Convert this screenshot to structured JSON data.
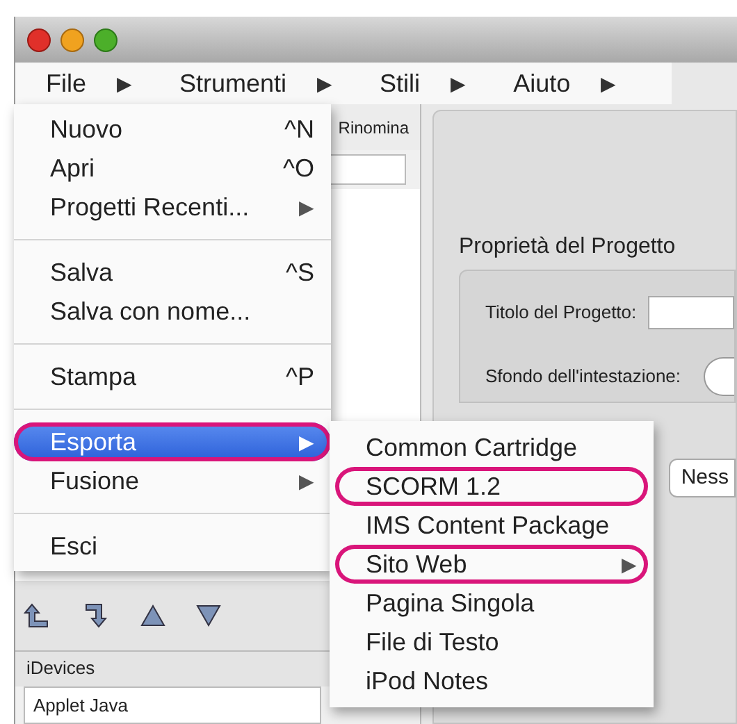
{
  "menubar": [
    {
      "label": "File",
      "arrow": "▶"
    },
    {
      "label": "Strumenti",
      "arrow": "▶"
    },
    {
      "label": "Stili",
      "arrow": "▶"
    },
    {
      "label": "Aiuto",
      "arrow": "▶"
    }
  ],
  "toolbar": {
    "label": "Rinomina"
  },
  "project_panel": {
    "title": "Proprietà del Progetto",
    "fields": [
      {
        "kind": "text",
        "label": "Titolo del Progetto:"
      },
      {
        "kind": "radio",
        "label": "Sfondo dell'intestazione:"
      }
    ],
    "button": "Ness"
  },
  "idevices": {
    "title": "iDevices",
    "items": [
      "Applet Java"
    ]
  },
  "file_menu": [
    {
      "kind": "item",
      "label": "Nuovo",
      "shortcut": "^N",
      "selected": false,
      "circled": false
    },
    {
      "kind": "item",
      "label": "Apri",
      "shortcut": "^O",
      "selected": false,
      "circled": false
    },
    {
      "kind": "item",
      "label": "Progetti Recenti...",
      "arrow": "▶",
      "selected": false,
      "circled": false
    },
    {
      "kind": "separator"
    },
    {
      "kind": "item",
      "label": "Salva",
      "shortcut": "^S",
      "selected": false,
      "circled": false
    },
    {
      "kind": "item",
      "label": "Salva con nome...",
      "selected": false,
      "circled": false
    },
    {
      "kind": "separator"
    },
    {
      "kind": "item",
      "label": "Stampa",
      "shortcut": "^P",
      "selected": false,
      "circled": false
    },
    {
      "kind": "separator"
    },
    {
      "kind": "item",
      "label": "Esporta",
      "arrow": "▶",
      "selected": true,
      "circled": true
    },
    {
      "kind": "item",
      "label": "Fusione",
      "arrow": "▶",
      "selected": false,
      "circled": false
    },
    {
      "kind": "separator"
    },
    {
      "kind": "item",
      "label": "Esci",
      "selected": false,
      "circled": false
    }
  ],
  "export_submenu": [
    {
      "label": "Common Cartridge",
      "circled": false
    },
    {
      "label": "SCORM 1.2",
      "circled": true
    },
    {
      "label": "IMS Content Package",
      "circled": false
    },
    {
      "label": "Sito Web",
      "arrow": "▶",
      "circled": true
    },
    {
      "label": "Pagina Singola",
      "circled": false
    },
    {
      "label": "File di Testo",
      "circled": false
    },
    {
      "label": "iPod Notes",
      "circled": false
    }
  ]
}
